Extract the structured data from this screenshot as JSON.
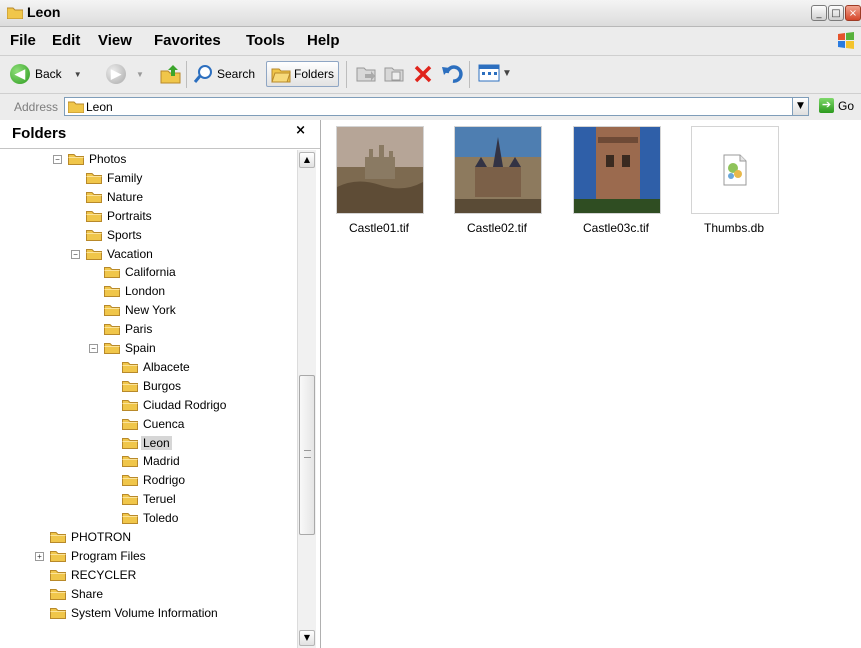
{
  "window": {
    "title": "Leon"
  },
  "menu": [
    "File",
    "Edit",
    "View",
    "Favorites",
    "Tools",
    "Help"
  ],
  "toolbar": {
    "back_label": "Back",
    "search_label": "Search",
    "folders_label": "Folders"
  },
  "address": {
    "label": "Address",
    "value": "Leon",
    "go_label": "Go"
  },
  "folder_pane": {
    "title": "Folders",
    "close": "×"
  },
  "tree": [
    {
      "label": "Photos",
      "depth": 1,
      "toggle": "−"
    },
    {
      "label": "Family",
      "depth": 2
    },
    {
      "label": "Nature",
      "depth": 2
    },
    {
      "label": "Portraits",
      "depth": 2
    },
    {
      "label": "Sports",
      "depth": 2
    },
    {
      "label": "Vacation",
      "depth": 2,
      "toggle": "−"
    },
    {
      "label": "California",
      "depth": 3
    },
    {
      "label": "London",
      "depth": 3
    },
    {
      "label": "New York",
      "depth": 3
    },
    {
      "label": "Paris",
      "depth": 3
    },
    {
      "label": "Spain",
      "depth": 3,
      "toggle": "−"
    },
    {
      "label": "Albacete",
      "depth": 4
    },
    {
      "label": "Burgos",
      "depth": 4
    },
    {
      "label": "Ciudad Rodrigo",
      "depth": 4
    },
    {
      "label": "Cuenca",
      "depth": 4
    },
    {
      "label": "Leon",
      "depth": 4,
      "selected": true
    },
    {
      "label": "Madrid",
      "depth": 4
    },
    {
      "label": "Rodrigo",
      "depth": 4
    },
    {
      "label": "Teruel",
      "depth": 4
    },
    {
      "label": "Toledo",
      "depth": 4
    },
    {
      "label": "PHOTRON",
      "depth": 0
    },
    {
      "label": "Program Files",
      "depth": 0,
      "toggle": "+"
    },
    {
      "label": "RECYCLER",
      "depth": 0
    },
    {
      "label": "Share",
      "depth": 0
    },
    {
      "label": "System Volume Information",
      "depth": 0
    }
  ],
  "files": [
    {
      "name": "Castle01.tif",
      "kind": "image"
    },
    {
      "name": "Castle02.tif",
      "kind": "image"
    },
    {
      "name": "Castle03c.tif",
      "kind": "image"
    },
    {
      "name": "Thumbs.db",
      "kind": "db"
    }
  ]
}
